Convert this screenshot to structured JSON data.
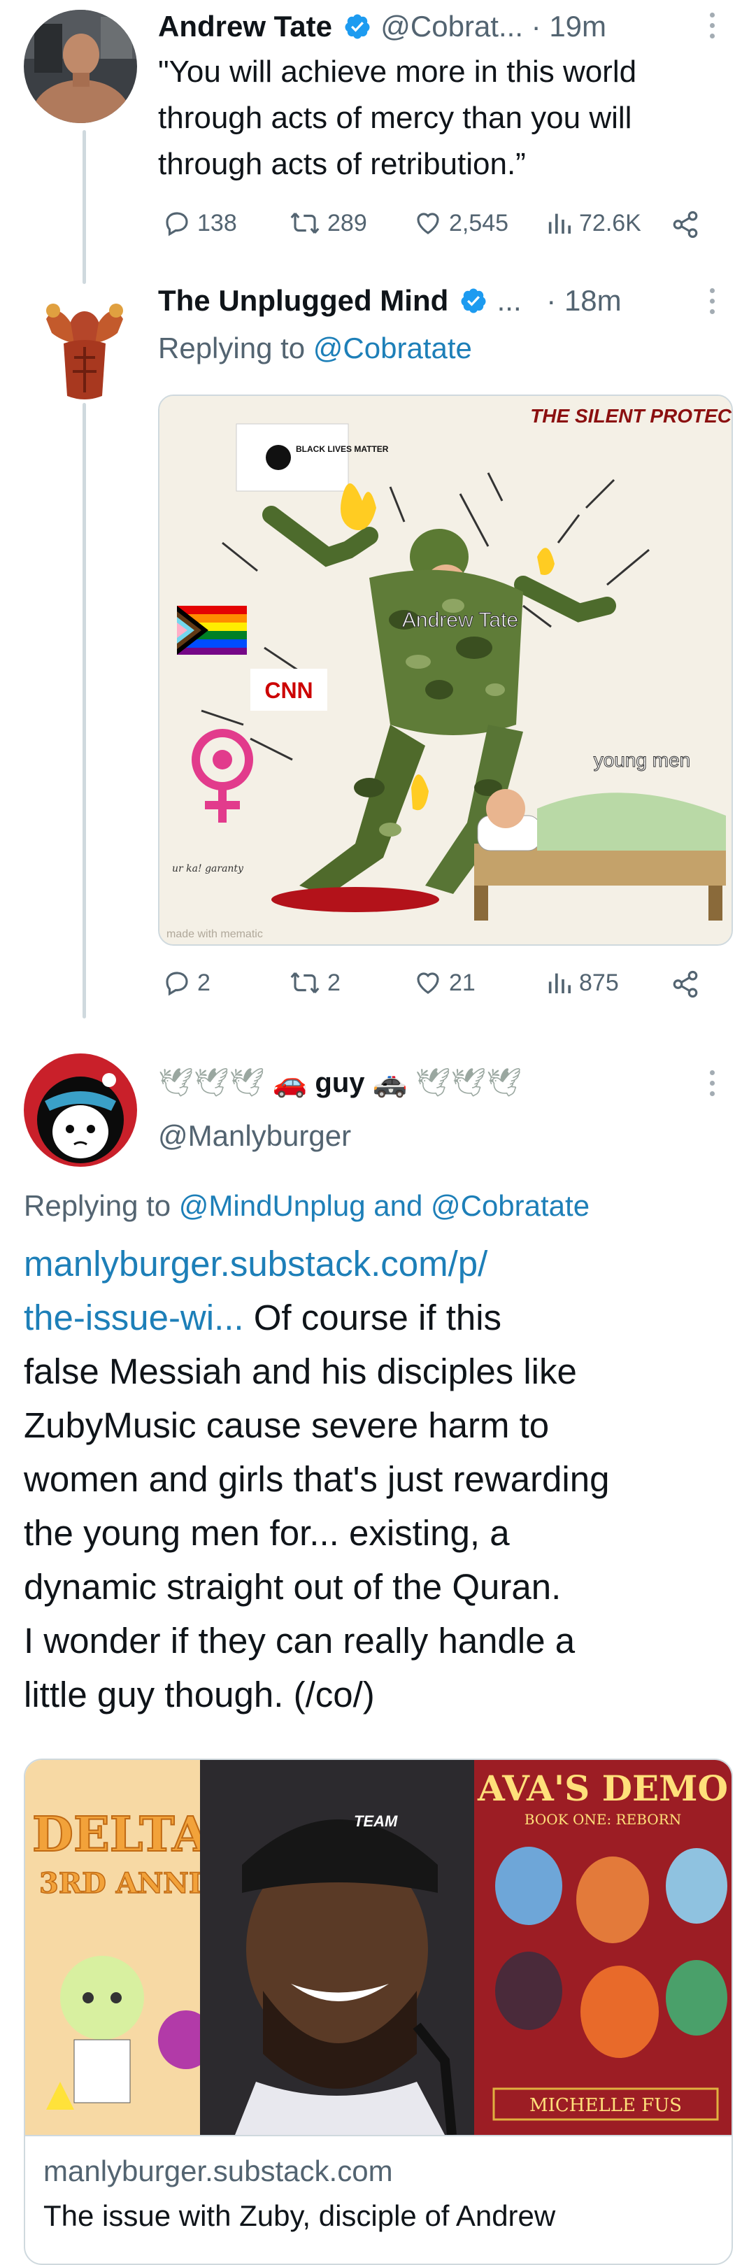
{
  "tweet1": {
    "author_name": "Andrew Tate",
    "handle": "@Cobrat...",
    "time": "· 19m",
    "text": "\"You will achieve more in this world through acts of mercy than you will through acts of retribution.”",
    "replies": "138",
    "retweets": "289",
    "likes": "2,545",
    "views": "72.6K"
  },
  "tweet2": {
    "author_name": "The Unplugged Mind",
    "handle": "...",
    "time": "· 18m",
    "replying_prefix": "Replying to",
    "replying_to": "@Cobratate",
    "meme": {
      "caption": "THE SILENT PROTEC",
      "sign_text": "BLACK LIVES MATTER",
      "soldier_label": "Andrew Tate",
      "news_label": "CNN",
      "sleeper_label": "young men",
      "scrawl_text": "ur ka! garanty",
      "watermark": "made with mematic"
    },
    "replies": "2",
    "retweets": "2",
    "likes": "21",
    "views": "875"
  },
  "tweet3": {
    "display_name": "guy",
    "handle": "@Manlyburger",
    "replying_prefix": "Replying to",
    "replying_to_1": "@MindUnplug",
    "replying_and": "and",
    "replying_to_2": "@Cobratate",
    "link_text": "manlyburger.substack.com/p/\nthe-issue-wi...",
    "text_lines": [
      "Of course if this",
      "false Messiah and his disciples like",
      "ZubyMusic cause severe harm to",
      "women and girls that's just rewarding",
      "the young men for... existing, a",
      "dynamic straight out of the Quran.",
      "I wonder if they can really handle a",
      "little guy though. (/co/)"
    ],
    "card": {
      "panel_left_text_1": "DELTA",
      "panel_left_text_2": "3RD ANNI",
      "panel_right_title": "AVA'S DEMO",
      "panel_right_subtitle": "BOOK ONE: REBORN",
      "panel_right_author": "MICHELLE FUS",
      "cap_text": "TEAM",
      "domain": "manlyburger.substack.com",
      "title": "The issue with Zuby, disciple of Andrew"
    }
  },
  "colors": {
    "verified": "#1d9bf0",
    "link": "#1d7fb8",
    "muted": "#536471",
    "thread_line": "#cfd9de"
  }
}
